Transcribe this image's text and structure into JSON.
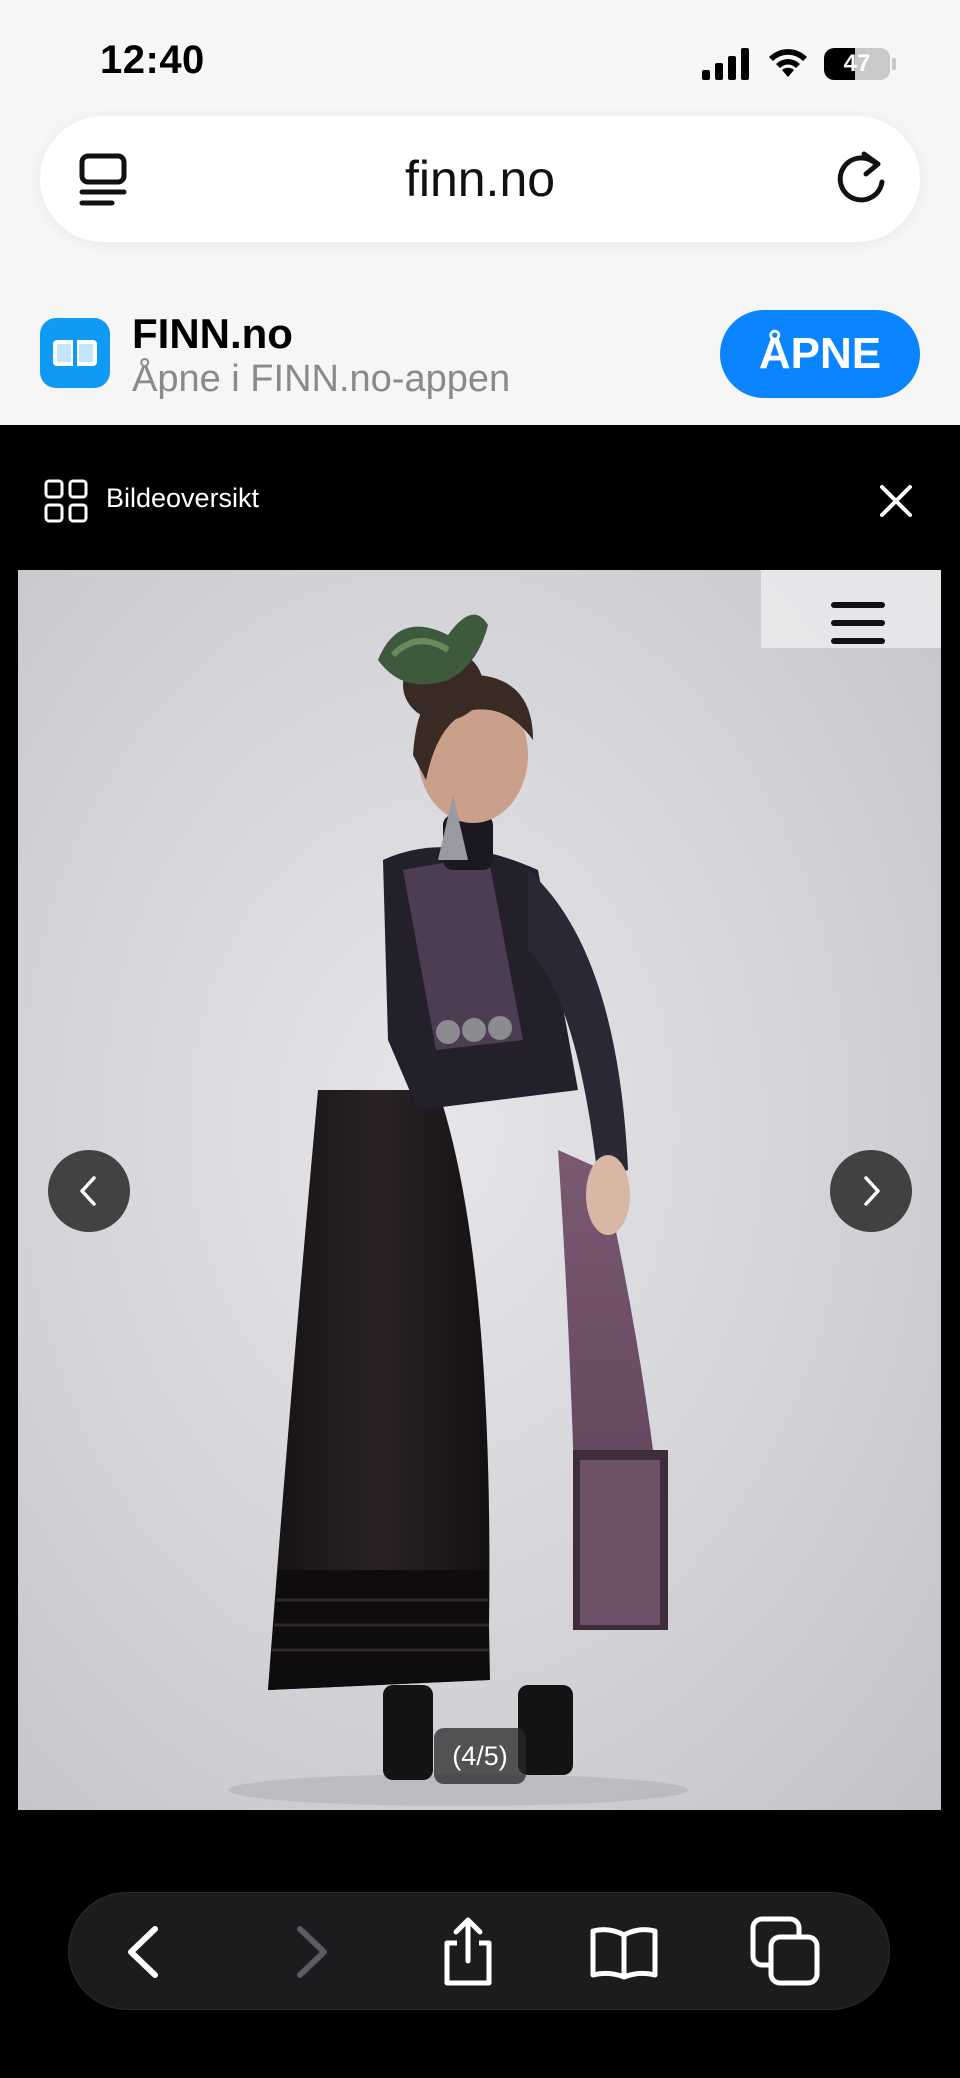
{
  "status_bar": {
    "time": "12:40",
    "battery": "47",
    "battery_level": 0.47,
    "icons": [
      "signal-icon",
      "wifi-icon",
      "battery-icon"
    ]
  },
  "url_bar": {
    "url": "finn.no",
    "left_icon": "tab-overview-icon",
    "right_icon": "reload-icon"
  },
  "app_banner": {
    "name": "FINN.no",
    "subtitle": "Åpne i FINN.no-appen",
    "open_label": "ÅPNE",
    "accent": "#0a84ff"
  },
  "gallery": {
    "overview_label": "Bildeoversikt",
    "counter": "(4/5)",
    "current": 4,
    "total": 5
  },
  "toolbar": {
    "buttons": [
      "back-icon",
      "forward-icon",
      "share-icon",
      "bookmarks-icon",
      "tabs-icon"
    ]
  }
}
